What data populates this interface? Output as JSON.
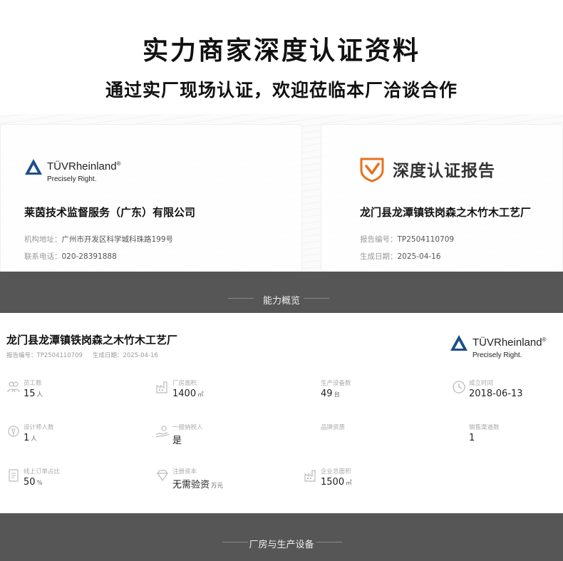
{
  "header": {
    "title": "实力商家深度认证资料",
    "subtitle": "通过实厂现场认证，欢迎莅临本厂洽谈合作"
  },
  "tuv": {
    "name": "TÜVRheinland",
    "registered": "®",
    "tagline": "Precisely Right.",
    "color": "#1a4f8b"
  },
  "left_card": {
    "company": "莱茵技术监督服务（广东）有限公司",
    "address_label": "机构地址：",
    "address": "广州市开发区科学城科珠路199号",
    "phone_label": "联系电话：",
    "phone": "020-28391888"
  },
  "right_card": {
    "report_title": "深度认证报告",
    "company": "龙门县龙潭镇铁岗森之木竹木工艺厂",
    "report_no_label": "报告编号：",
    "report_no": "TP2504110709",
    "date_label": "生成日期：",
    "date": "2025-04-16",
    "accent_color": "#e8711f"
  },
  "section1": {
    "label": "能力概览"
  },
  "panel": {
    "company": "龙门县龙潭镇铁岗森之木竹木工艺厂",
    "report_no": "报告编号：TP2504110709",
    "date": "生成日期：2025-04-16",
    "stats": [
      {
        "label": "员工数",
        "value": "15",
        "unit": "人",
        "icon": "people-icon"
      },
      {
        "label": "厂房面积",
        "value": "1400",
        "unit": "㎡",
        "icon": "factory-icon"
      },
      {
        "label": "生产设备数",
        "value": "49",
        "unit": "台",
        "icon": ""
      },
      {
        "label": "成立时间",
        "value": "2018-06-13",
        "unit": "",
        "icon": "clock-icon"
      },
      {
        "label": "设计师人数",
        "value": "1",
        "unit": "人",
        "icon": "medal-icon"
      },
      {
        "label": "一般纳税人",
        "value": "是",
        "unit": "",
        "icon": "hand-coin-icon"
      },
      {
        "label": "品牌资质",
        "value": "",
        "unit": "",
        "icon": ""
      },
      {
        "label": "销售渠道数",
        "value": "1",
        "unit": "",
        "icon": ""
      },
      {
        "label": "线上订单占比",
        "value": "50",
        "unit": "%",
        "icon": "document-icon"
      },
      {
        "label": "注册资本",
        "value": "无需验资",
        "unit": "万元",
        "icon": "diamond-icon"
      },
      {
        "label": "企业总面积",
        "value": "1500",
        "unit": "㎡",
        "icon": "factory-icon"
      }
    ]
  },
  "section2": {
    "label": "厂房与生产设备"
  }
}
